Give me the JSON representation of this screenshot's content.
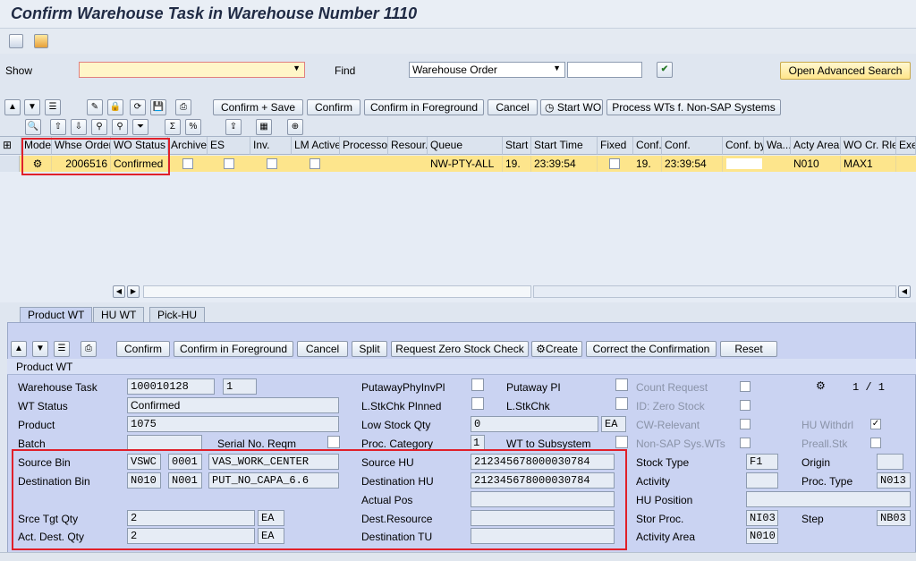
{
  "title": "Confirm Warehouse Task in Warehouse Number 1110",
  "header": {
    "show_label": "Show",
    "show_value": "",
    "find_label": "Find",
    "find_select": "Warehouse Order",
    "find_value": "",
    "advanced_search": "Open Advanced Search"
  },
  "wo_toolbar": {
    "confirm_save": "Confirm + Save",
    "confirm": "Confirm",
    "confirm_foreground": "Confirm in Foreground",
    "cancel": "Cancel",
    "start_wo": "Start WO",
    "process_wts": "Process WTs f. Non-SAP Systems"
  },
  "grid": {
    "columns": [
      "Mode",
      "Whse Order",
      "WO Status",
      "Archive",
      "ES",
      "Inv.",
      "LM Active",
      "Processor",
      "Resour...",
      "Queue",
      "Start",
      "Start Time",
      "Fixed",
      "Conf.",
      "Conf.",
      "Conf. by",
      "Wa...",
      "Acty Area",
      "WO Cr. Rle",
      "Exe"
    ],
    "row": {
      "whse_order": "2006516",
      "wo_status": "Confirmed",
      "queue": "NW-PTY-ALL",
      "start": "19.",
      "start_time": "23:39:54",
      "conf": "19.",
      "conf_time": "23:39:54",
      "acty_area": "N010",
      "wo_cr_rle": "MAX1"
    }
  },
  "tabs": [
    "Product WT",
    "HU WT",
    "Pick-HU"
  ],
  "wt_toolbar": {
    "confirm": "Confirm",
    "confirm_foreground": "Confirm in Foreground",
    "cancel": "Cancel",
    "split": "Split",
    "request_zero": "Request Zero Stock Check",
    "create": "Create",
    "correct": "Correct the Confirmation",
    "reset": "Reset"
  },
  "section_title": "Product WT",
  "left_fields": {
    "warehouse_task_label": "Warehouse Task",
    "warehouse_task": "100010128",
    "warehouse_task_item": "1",
    "wt_status_label": "WT Status",
    "wt_status": "Confirmed",
    "product_label": "Product",
    "product": "1075",
    "batch_label": "Batch",
    "serial_label": "Serial No. Reqm",
    "source_bin_label": "Source Bin",
    "source_bin_1": "VSWC",
    "source_bin_2": "0001",
    "source_bin_3": "VAS_WORK_CENTER",
    "dest_bin_label": "Destination Bin",
    "dest_bin_1": "N010",
    "dest_bin_2": "N001",
    "dest_bin_3": "PUT_NO_CAPA_6.6",
    "srce_tgt_label": "Srce Tgt Qty",
    "srce_tgt_qty": "2",
    "srce_tgt_unit": "EA",
    "act_dest_label": "Act. Dest. Qty",
    "act_dest_qty": "2",
    "act_dest_unit": "EA"
  },
  "mid_fields": {
    "putaway_phy_label": "PutawayPhyInvPl",
    "putaway_pi_label": "Putaway PI",
    "lstk_plnned_label": "L.StkChk Plnned",
    "lstkchk_label": "L.StkChk",
    "low_stock_label": "Low Stock Qty",
    "low_stock_value": "0",
    "low_stock_unit": "EA",
    "proc_cat_label": "Proc. Category",
    "proc_cat_value": "1",
    "wt_subsystem_label": "WT to Subsystem",
    "source_hu_label": "Source HU",
    "source_hu": "212345678000030784",
    "dest_hu_label": "Destination HU",
    "dest_hu": "212345678000030784",
    "actual_pos_label": "Actual Pos",
    "dest_resource_label": "Dest.Resource",
    "dest_tu_label": "Destination TU"
  },
  "right_fields": {
    "count_request_label": "Count Request",
    "pager": "1 / 1",
    "id_zero_label": "ID: Zero Stock",
    "cw_relevant_label": "CW-Relevant",
    "hu_withdrl_label": "HU Withdrl",
    "non_sap_label": "Non-SAP Sys.WTs",
    "preall_label": "Preall.Stk",
    "stock_type_label": "Stock Type",
    "stock_type": "F1",
    "origin_label": "Origin",
    "activity_label": "Activity",
    "proc_type_label": "Proc. Type",
    "proc_type": "N013",
    "hu_position_label": "HU Position",
    "stor_proc_label": "Stor Proc.",
    "stor_proc": "NI03",
    "step_label": "Step",
    "step": "NB03",
    "activity_area_label": "Activity Area",
    "activity_area": "N010"
  },
  "colors": {
    "highlight": "#fde58c",
    "annotation": "#e0202a",
    "panel": "#cad3f2"
  }
}
